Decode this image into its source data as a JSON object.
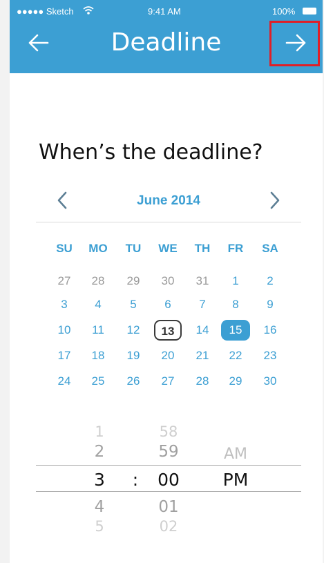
{
  "status": {
    "carrier": "●●●●● Sketch",
    "time": "9:41 AM",
    "battery": "100%"
  },
  "nav": {
    "title": "Deadline"
  },
  "question": "When’s the deadline?",
  "calendar": {
    "month": "June 2014",
    "weekdays": [
      "SU",
      "MO",
      "TU",
      "WE",
      "TH",
      "FR",
      "SA"
    ],
    "weeks": [
      [
        "27",
        "28",
        "29",
        "30",
        "31",
        "1",
        "2"
      ],
      [
        "3",
        "4",
        "5",
        "6",
        "7",
        "8",
        "9"
      ],
      [
        "10",
        "11",
        "12",
        "13",
        "14",
        "15",
        "16"
      ],
      [
        "17",
        "18",
        "19",
        "20",
        "21",
        "22",
        "23"
      ],
      [
        "24",
        "25",
        "26",
        "27",
        "28",
        "29",
        "30"
      ]
    ],
    "today": "13",
    "selected": "15"
  },
  "picker": {
    "hours": {
      "above": [
        "1",
        "2"
      ],
      "selected": "3",
      "below": [
        "4",
        "5"
      ]
    },
    "separator": ":",
    "minutes": {
      "above": [
        "58",
        "59"
      ],
      "selected": "00",
      "below": [
        "01",
        "02"
      ]
    },
    "ampm": {
      "above": "AM",
      "selected": "PM"
    }
  },
  "colors": {
    "accent": "#3c9fd3",
    "highlight": "#e01f27"
  }
}
